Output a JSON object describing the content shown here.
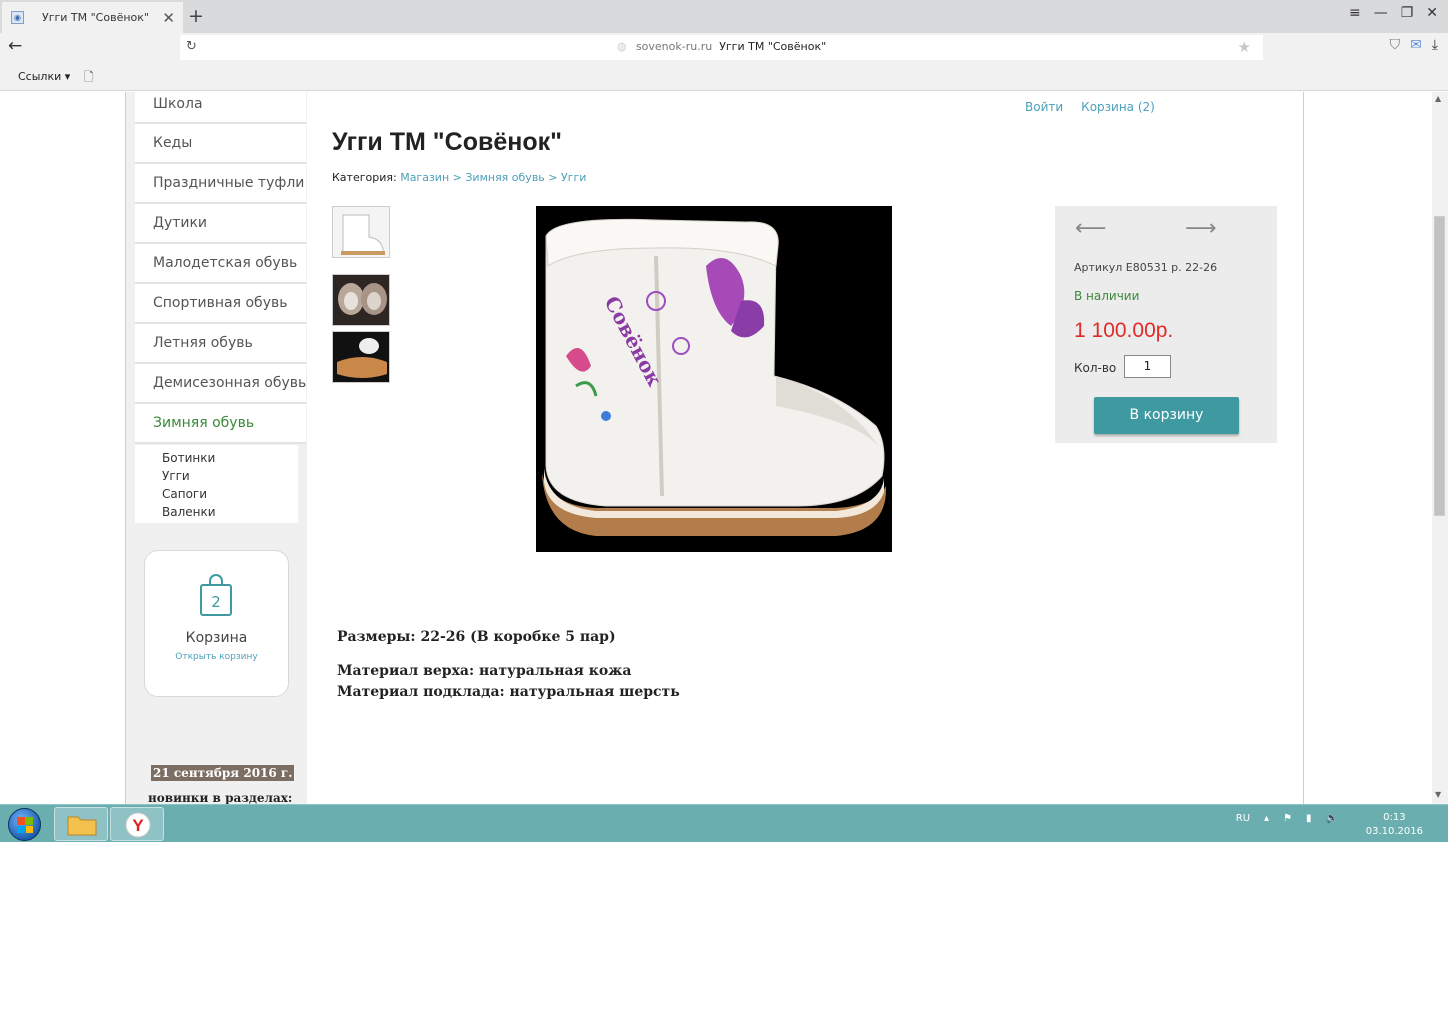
{
  "browser": {
    "tab_title": "Угги ТМ \"Совёнок\"",
    "tab_close": "✕",
    "new_tab": "+",
    "back_arrow": "←",
    "reload_icon": "↻",
    "url_domain": "sovenok-ru.ru",
    "url_title": "Угги ТМ \"Совёнок\"",
    "star_icon": "★",
    "bookmarks_label": "Ссылки ▾",
    "window_controls": [
      "≡",
      "—",
      "❐",
      "✕"
    ]
  },
  "sidebar": {
    "menu": [
      {
        "label": "Школа"
      },
      {
        "label": "Кеды"
      },
      {
        "label": "Праздничные туфли"
      },
      {
        "label": "Дутики"
      },
      {
        "label": "Малодетская обувь"
      },
      {
        "label": "Спортивная обувь"
      },
      {
        "label": "Летняя обувь"
      },
      {
        "label": "Демисезонная обувь"
      },
      {
        "label": "Зимняя обувь"
      }
    ],
    "submenu": [
      "Ботинки",
      "Угги",
      "Сапоги",
      "Валенки"
    ],
    "cart": {
      "count": "2",
      "label": "Корзина",
      "open_link": "Открыть корзину"
    },
    "news_date": "21 сентября 2016 г.",
    "news_text": "новинки в разделах:"
  },
  "header_links": {
    "login": "Войти",
    "cart": "Корзина (2)"
  },
  "product": {
    "title": "Угги ТМ \"Совёнок\"",
    "category_label": "Категория:",
    "breadcrumb": [
      "Магазин",
      "Зимняя обувь",
      "Угги"
    ],
    "breadcrumb_sep": ">",
    "article": "Артикул E80531 р. 22-26",
    "availability": "В наличии",
    "price": "1 100.00р.",
    "qty_label": "Кол-во",
    "qty_value": "1",
    "buy_button": "В корзину",
    "prev_arrow": "⟵",
    "next_arrow": "⟶",
    "sizes": "Размеры: 22-26 (В коробке 5 пар)",
    "material_top": "Материал верха: натуральная кожа",
    "material_lining": "Материал подклада: натуральная шерсть",
    "boot_embroidery": "Совёнок"
  },
  "taskbar": {
    "lang": "RU",
    "time": "0:13",
    "date": "03.10.2016"
  }
}
